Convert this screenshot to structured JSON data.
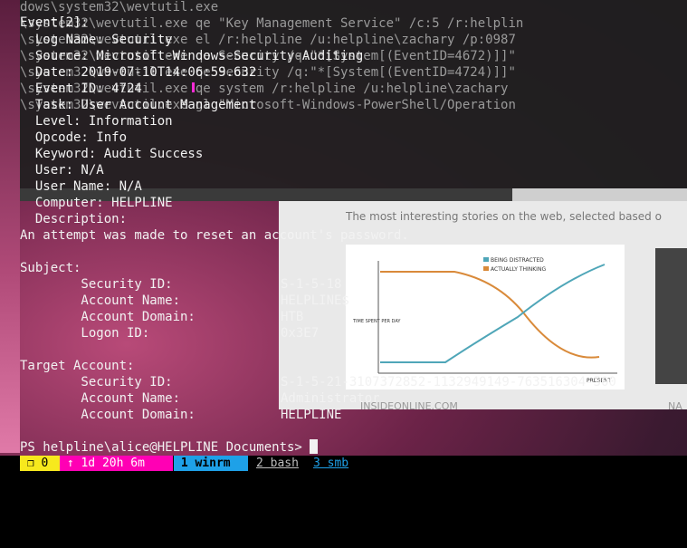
{
  "back_terminal": {
    "lines": [
      "dows\\system32\\wevtutil.exe",
      "\\system32\\wevtutil.exe qe \"Key Management Service\" /c:5 /r:helplin",
      "\\system32\\wevtutil.exe el /r:helpline /u:helpline\\zachary /p:0987",
      "\\system32\\wevtutil.exe qe Security /q:\"*[System[(EventID=4672)]]\"",
      "\\system32\\wevtutil.exe qe Security /q:\"*[System[(EventID=4724)]]\"",
      "\\system32\\wevtutil.exe qe system /r:helpline /u:helpline\\zachary",
      "\\system32\\wevtutil.exe gl \"Microsoft-Windows-PowerShell/Operation"
    ]
  },
  "browser": {
    "tagline": "The most interesting stories on the web, selected based o",
    "chart_legend_1": "BEING DISTRACTED",
    "chart_legend_2": "ACTUALLY THINKING",
    "chart_ylabel": "TIME SPENT PER DAY",
    "chart_x_right": "PRESENT",
    "source_1": "INSIDEONLINE.COM",
    "source_2": "NA"
  },
  "event": {
    "header": "Event[2]:",
    "log_name": "  Log Name: Security",
    "source": "  Source: Microsoft-Windows-Security-Auditing",
    "date": "  Date: 2019-07-10T14:06:59.632",
    "event_id": "  Event ID: 4724",
    "task": "  Task: User Account Management",
    "level": "  Level: Information",
    "opcode": "  Opcode: Info",
    "keyword": "  Keyword: Audit Success",
    "user": "  User: N/A",
    "user_name": "  User Name: N/A",
    "computer": "  Computer: HELPLINE",
    "description_label": "  Description:",
    "description": "An attempt was made to reset an account's password.",
    "subject_label": "Subject:",
    "subject": [
      {
        "key": "        Security ID:",
        "value": "S-1-5-18"
      },
      {
        "key": "        Account Name:",
        "value": "HELPLINE$"
      },
      {
        "key": "        Account Domain:",
        "value": "HTB"
      },
      {
        "key": "        Logon ID:",
        "value": "0x3E7"
      }
    ],
    "target_label": "Target Account:",
    "target": [
      {
        "key": "        Security ID:",
        "value": "S-1-5-21-3107372852-1132949149-763516304-500"
      },
      {
        "key": "        Account Name:",
        "value": "Administrator"
      },
      {
        "key": "        Account Domain:",
        "value": "HELPLINE"
      }
    ]
  },
  "prompt": "PS helpline\\alice@HELPLINE Documents> ",
  "status_bar": {
    "session": " ❐ 0 ",
    "uptime": " ↑ 1d 20h 6m ",
    "win1": " 1 winrm ",
    "win2": "2 bash",
    "win3": "3 smb",
    "colors": {
      "session_bg": "#f7e91d",
      "uptime_bg": "#ff00b4",
      "win1_bg": "#1ea1e8"
    }
  }
}
